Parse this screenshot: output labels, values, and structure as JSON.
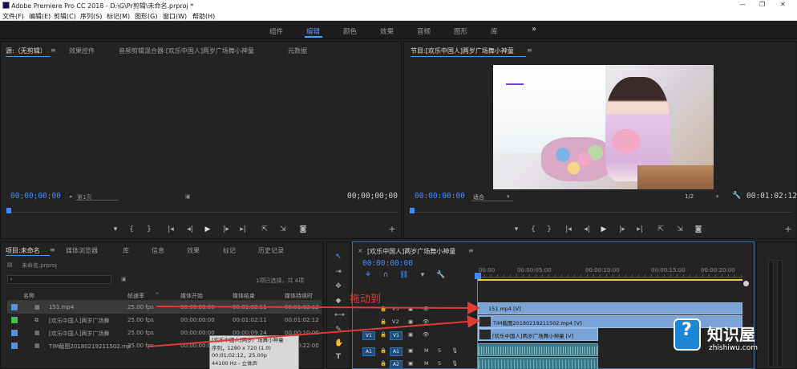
{
  "window": {
    "title": "Adobe Premiere Pro CC 2018 - D:\\G\\Pr剪辑\\未命名.prproj *",
    "controls": [
      "—",
      "❐",
      "✕"
    ]
  },
  "menu": [
    "文件(F)",
    "编辑(E)",
    "剪辑(C)",
    "序列(S)",
    "标记(M)",
    "图形(G)",
    "窗口(W)",
    "帮助(H)"
  ],
  "workspaces": {
    "items": [
      "组件",
      "编辑",
      "颜色",
      "效果",
      "音频",
      "图形",
      "库"
    ],
    "active": "编辑",
    "overflow": "»"
  },
  "source_panel": {
    "tabs": [
      "源:（无剪辑）",
      "效果控件",
      "音频剪辑混合器:[欢乐中国人]两岁广场舞小神童",
      "元数据"
    ],
    "timecode_left": "00;00;00;00",
    "page_select": "第1页",
    "timecode_right": "00;00;00;00",
    "transport": [
      "▾",
      "{",
      "}",
      "|◂",
      "◂|",
      "▶",
      "|▸",
      "▸|",
      "⇱",
      "⇲",
      "◙"
    ],
    "add": "+"
  },
  "program_panel": {
    "tab": "节目:[欢乐中国人]两岁广场舞小神童",
    "timecode_left": "00:00:00:00",
    "fit": "适合",
    "resolution": "1/2",
    "timecode_right": "00:01:02:12",
    "transport": [
      "▾",
      "{",
      "}",
      "|◂",
      "◂|",
      "▶",
      "|▸",
      "▸|",
      "⇱",
      "⇲",
      "◙"
    ],
    "add": "+"
  },
  "project_panel": {
    "tabs": [
      "项目:未命名",
      "媒体浏览器",
      "库",
      "信息",
      "效果",
      "标记",
      "历史记录"
    ],
    "project_file": "未命名.prproj",
    "selection_status": "1项已选择，共 4项",
    "columns": [
      "名称",
      "帧速率",
      "媒体开始",
      "媒体结束",
      "媒体持续时"
    ],
    "rows": [
      {
        "name": "151.mp4",
        "fps": "25.00 fps",
        "start": "00:00:00:00",
        "end": "00:01:02:11",
        "dur": "00:01:02:12",
        "color": "#5b8fd6"
      },
      {
        "name": "[欢乐中国人]两岁广场舞",
        "fps": "25.00 fps",
        "start": "00:00:00:00",
        "end": "00:01:02:11",
        "dur": "00:01:02:12",
        "color": "#3fbf55"
      },
      {
        "name": "[欢乐中国人]两岁广场舞",
        "fps": "25.00 fps",
        "start": "00:00:00:00",
        "end": "00:00:09:24",
        "dur": "00:00:10:00",
        "color": "#5b8fd6"
      },
      {
        "name": "TIM截图20180219211502.mp",
        "fps": "25.00 fps",
        "start": "00:00:00:00",
        "end": "",
        "dur": "00:00:22:00",
        "color": "#5b8fd6"
      }
    ],
    "tooltip": [
      "[欢乐中国人]两岁广场舞小神童",
      "序列，1280 x 720 (1.0)",
      "00;01;02;12，25.00p",
      "44100 Hz - 立体声"
    ]
  },
  "annotation": {
    "text": "拖动到",
    "color": "#e03a3a"
  },
  "timeline": {
    "tab": "[欢乐中国人]两岁广场舞小神童",
    "timecode": "00:00:00:00",
    "ruler": [
      "00:00",
      "00:00:05:00",
      "00:00:10:00",
      "00:00:15:00",
      "00:00:20:00"
    ],
    "tracks": [
      {
        "id": "V3",
        "label": "V3"
      },
      {
        "id": "V2",
        "label": "V2"
      },
      {
        "id": "V1",
        "label": "V1",
        "src": "V1"
      },
      {
        "id": "A1",
        "label": "A1",
        "src": "A1",
        "m": "M",
        "s": "S"
      },
      {
        "id": "A2",
        "label": "A2",
        "m": "M",
        "s": "S"
      }
    ],
    "clips": {
      "v3": "151.mp4 [V]",
      "v2": "TIM截图20180219211502.mp4 [V]",
      "v1": "[欢乐中国人]两岁广场舞小神童 [V]"
    }
  },
  "watermark": {
    "title": "知识屋",
    "url": "zhishiwu.com"
  },
  "colors": {
    "accent_blue": "#3c8cff",
    "video_clip": "#7aa3d6",
    "audio_clip": "#3c7a8a",
    "arrow": "#e03a3a"
  }
}
